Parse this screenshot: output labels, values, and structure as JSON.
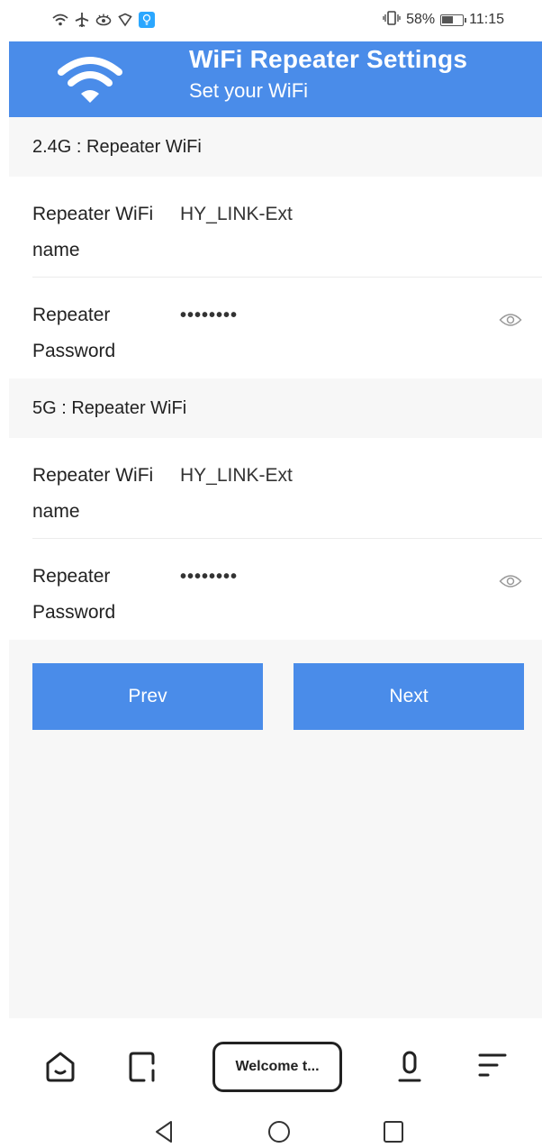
{
  "status_bar": {
    "battery_pct": "58%",
    "time": "11:15"
  },
  "header": {
    "title": "WiFi Repeater Settings",
    "subtitle": "Set your WiFi"
  },
  "sections": [
    {
      "heading": "2.4G : Repeater WiFi",
      "name_label_line1": "Repeater WiFi",
      "name_label_line2": "name",
      "name_value": "HY_LINK-Ext",
      "pwd_label_line1": "Repeater",
      "pwd_label_line2": "Password",
      "pwd_value": "••••••••"
    },
    {
      "heading": "5G : Repeater WiFi",
      "name_label_line1": "Repeater WiFi",
      "name_label_line2": "name",
      "name_value": "HY_LINK-Ext",
      "pwd_label_line1": "Repeater",
      "pwd_label_line2": "Password",
      "pwd_value": "••••••••"
    }
  ],
  "buttons": {
    "prev": "Prev",
    "next": "Next"
  },
  "browser": {
    "tab_title": "Welcome t..."
  },
  "colors": {
    "accent": "#4a8ce9",
    "background": "#f7f7f7"
  },
  "icons": {
    "header": "wifi-icon",
    "password_toggle": "eye-icon",
    "home": "home-icon",
    "tabs": "tabs-icon",
    "voice": "microphone-icon",
    "menu": "menu-icon",
    "back": "back-triangle-icon",
    "home_nav": "home-circle-icon",
    "recents": "recents-square-icon"
  }
}
